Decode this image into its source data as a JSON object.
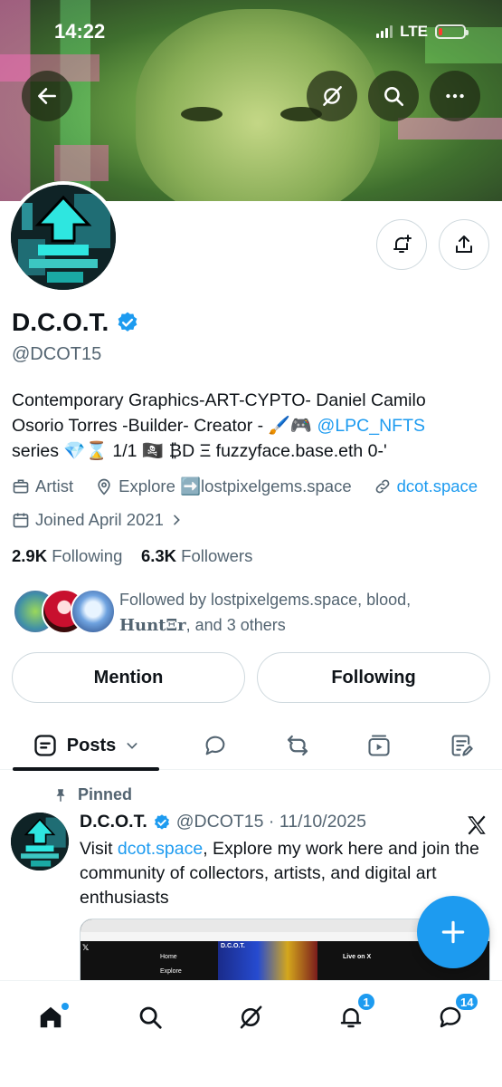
{
  "status_bar": {
    "time": "14:22",
    "network": "LTE"
  },
  "profile": {
    "name": "D.C.O.T.",
    "handle": "@DCOT15",
    "bio_line1": "Contemporary Graphics-ART-CYPTO- Daniel Camilo",
    "bio_line2_text": "Osorio Torres -Builder- Creator - 🖌️🎮",
    "bio_mention": "@LPC_NFTS",
    "bio_line3": "series 💎⌛ 1/1 🏴‍☠️ ₿D Ξ fuzzyface.base.eth 0-'",
    "category": "Artist",
    "location": "Explore ➡️lostpixelgems.space",
    "website": "dcot.space",
    "joined": "Joined April 2021",
    "following_count": "2.9K",
    "following_label": "Following",
    "followers_count": "6.3K",
    "followers_label": "Followers",
    "followed_by_prefix": "Followed by lostpixelgems.space, blood,",
    "followed_by_bold": "HuntΞr",
    "followed_by_suffix": ", and 3 others"
  },
  "actions": {
    "mention": "Mention",
    "following": "Following"
  },
  "tabs": {
    "posts": "Posts"
  },
  "post": {
    "pinned_label": "Pinned",
    "author": "D.C.O.T.",
    "handle_date": "@DCOT15 · 11/10/2025",
    "text_prefix": "Visit ",
    "text_link": "dcot.space",
    "text_suffix": ", Explore my work here and join the community of collectors, artists, and digital art enthusiasts",
    "preview_title": "D.C.O.T.",
    "preview_nav_home": "Home",
    "preview_nav_explore": "Explore",
    "preview_live": "Live on X"
  },
  "nav_badges": {
    "notifications": "1",
    "messages": "14"
  },
  "colors": {
    "accent": "#1d9bf0",
    "text": "#0f1419",
    "secondary": "#536471",
    "battery": "#ff3b30"
  }
}
